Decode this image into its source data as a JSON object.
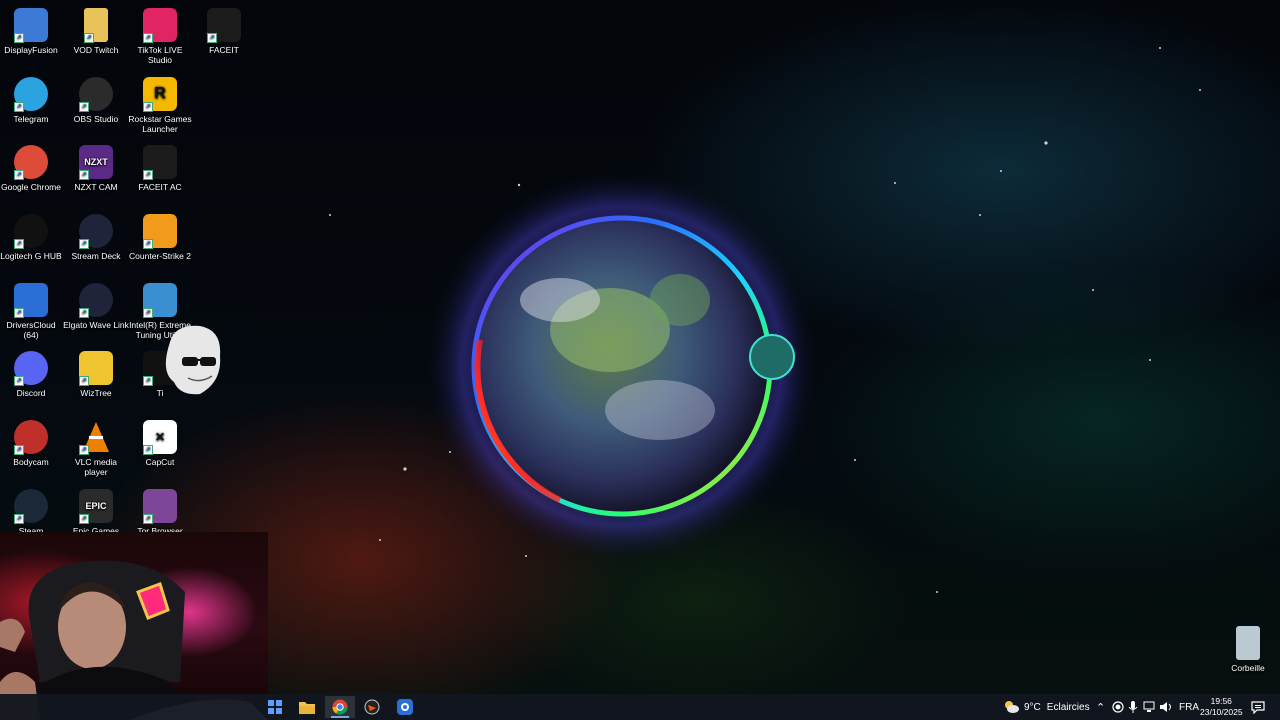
{
  "desktop": {
    "icons": [
      {
        "label": "DisplayFusion",
        "color": "#3b7bd6",
        "icon": "displayfusion-icon"
      },
      {
        "label": "VOD Twitch",
        "color": "#e8c35a",
        "icon": "folder-icon"
      },
      {
        "label": "TikTok LIVE Studio",
        "color": "#e02464",
        "icon": "tiktok-live-icon"
      },
      {
        "label": "FACEIT",
        "color": "#1b1b1b",
        "icon": "faceit-icon"
      },
      {
        "label": "Telegram",
        "color": "#2aa3e0",
        "icon": "telegram-icon"
      },
      {
        "label": "OBS Studio",
        "color": "#2b2b2b",
        "icon": "obs-icon"
      },
      {
        "label": "Rockstar Games Launcher",
        "color": "#f5b800",
        "icon": "rockstar-icon"
      },
      {
        "label": "Google Chrome",
        "color": "#dd4b39",
        "icon": "chrome-icon"
      },
      {
        "label": "NZXT CAM",
        "color": "#5b2a86",
        "icon": "nzxt-icon"
      },
      {
        "label": "FACEIT AC",
        "color": "#1b1b1b",
        "icon": "faceit-ac-icon"
      },
      {
        "label": "Logitech G HUB",
        "color": "#111111",
        "icon": "logitech-icon"
      },
      {
        "label": "Stream Deck",
        "color": "#20243a",
        "icon": "stream-deck-icon"
      },
      {
        "label": "Counter-Strike 2",
        "color": "#f19b1a",
        "icon": "counter-strike-icon"
      },
      {
        "label": "DriversCloud (64)",
        "color": "#2b6fd6",
        "icon": "driverscloud-icon"
      },
      {
        "label": "Elgato Wave Link",
        "color": "#20243a",
        "icon": "wave-link-icon"
      },
      {
        "label": "Intel(R) Extreme Tuning Utility",
        "color": "#3a8fd1",
        "icon": "intel-xtu-icon"
      },
      {
        "label": "Discord",
        "color": "#5865f2",
        "icon": "discord-icon"
      },
      {
        "label": "WizTree",
        "color": "#f0c330",
        "icon": "wiztree-icon"
      },
      {
        "label": "Ti",
        "color": "#111111",
        "icon": "tiktok-icon"
      },
      {
        "label": "Bodycam",
        "color": "#c0302a",
        "icon": "bodycam-icon"
      },
      {
        "label": "VLC media player",
        "color": "#f07f00",
        "icon": "vlc-icon"
      },
      {
        "label": "CapCut",
        "color": "#ffffff",
        "icon": "capcut-icon"
      },
      {
        "label": "Steam",
        "color": "#1b2838",
        "icon": "steam-icon"
      },
      {
        "label": "Epic Games",
        "color": "#2a2a2a",
        "icon": "epic-games-icon"
      },
      {
        "label": "Tor Browser",
        "color": "#7d4698",
        "icon": "tor-icon"
      },
      {
        "label": "Corbeille",
        "color": "#d8e8f0",
        "icon": "recycle-bin-icon"
      }
    ],
    "icon_glyphs": {
      "nzxt": "NZXT",
      "epic": "EPIC",
      "rockstar": "R"
    }
  },
  "taskbar": {
    "apps": [
      "start",
      "file-explorer",
      "chrome",
      "faceit",
      "driverscloud"
    ],
    "weather_temp": "9°C",
    "weather_text": "Eclaircies",
    "language": "FRA",
    "time": "19:56",
    "date": "23/10/2025"
  },
  "colors": {
    "taskbar_bg": "#12161e",
    "active_indicator": "#7aa7e8"
  }
}
